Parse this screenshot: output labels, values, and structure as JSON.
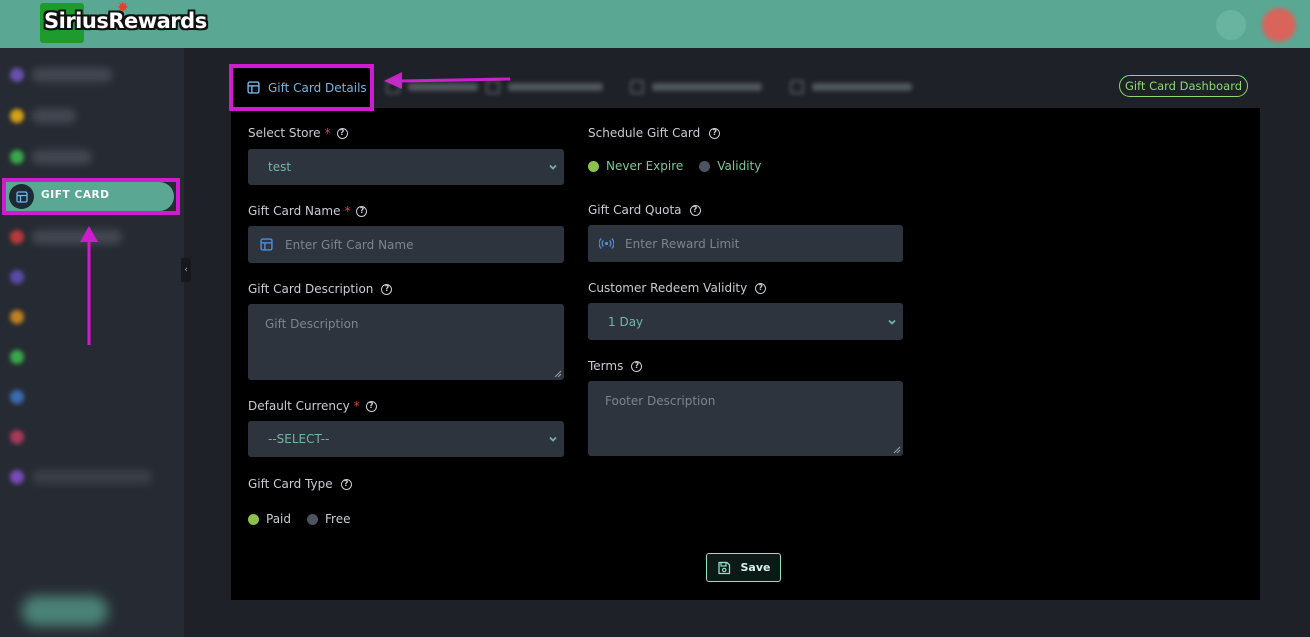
{
  "header": {
    "logo_text": "SiriusRewards",
    "brand_color": "#5aa894"
  },
  "sidebar": {
    "active_item": {
      "label": "GIFT CARD",
      "icon": "gift-card-icon"
    }
  },
  "tabs": {
    "active_label": "Gift Card Details",
    "dashboard_button": "Gift Card Dashboard"
  },
  "form": {
    "select_store": {
      "label": "Select Store",
      "value": "test"
    },
    "gift_card_name": {
      "label": "Gift Card Name",
      "placeholder": "Enter Gift Card Name"
    },
    "gift_card_description": {
      "label": "Gift Card Description",
      "placeholder": "Gift  Description"
    },
    "default_currency": {
      "label": "Default Currency",
      "value": "--SELECT--"
    },
    "gift_card_type": {
      "label": "Gift Card Type",
      "options": [
        "Paid",
        "Free"
      ],
      "selected": "Paid"
    },
    "schedule_gift_card": {
      "label": "Schedule Gift Card",
      "options": [
        "Never Expire",
        "Validity"
      ],
      "selected": "Never Expire"
    },
    "gift_card_quota": {
      "label": "Gift Card Quota",
      "placeholder": "Enter Reward Limit"
    },
    "customer_redeem_validity": {
      "label": "Customer Redeem Validity",
      "value": "1 Day"
    },
    "terms": {
      "label": "Terms",
      "placeholder": "Footer Description"
    },
    "required_mark": "*",
    "help_mark": "?",
    "save_label": "Save"
  },
  "colors": {
    "accent_green": "#8bc34a",
    "highlight_magenta": "#d11bd0",
    "required_red": "#e2453c"
  }
}
